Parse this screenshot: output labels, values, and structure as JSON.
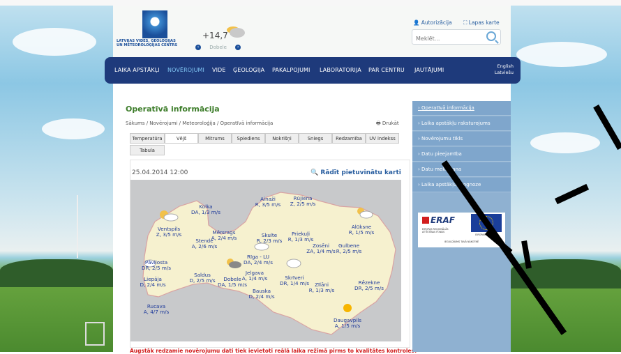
{
  "header": {
    "logo_text": "LATVIJAS VIDES, ĢEOLOĢIJAS UN METEOROLOĢIJAS CENTRS",
    "temperature": "+14,7",
    "city": "Dobele",
    "auth_link": "Autorizācija",
    "sitemap_link": "Lapas karte",
    "search_placeholder": "Meklēt..."
  },
  "nav": {
    "items": [
      "LAIKA APSTĀKĻI",
      "NOVĒROJUMI",
      "VIDE",
      "ĢEOLOĢIJA",
      "PAKALPOJUMI",
      "LABORATORIJA",
      "PAR CENTRU",
      "JAUTĀJUMI"
    ],
    "active_index": 1,
    "lang_en": "English",
    "lang_lv": "Latviešu"
  },
  "content": {
    "title": "Operatīvā informācija",
    "breadcrumb": "Sākums / Novērojumi / Meteoroloģija / Operatīvā informācija",
    "print": "Drukāt",
    "tabs": [
      "Temperatūra",
      "Vējš",
      "Mitrums",
      "Spiediens",
      "Nokrišņi",
      "Sniegs",
      "Redzamība",
      "UV indekss",
      "Tabula"
    ],
    "active_tab": 1,
    "date": "25.04.2014 12:00",
    "show_map": "Rādīt pietuvinātu karti",
    "warning": "Augstāk redzamie novērojumu dati tiek ievietoti reālā laika režīmā pirms to kvalitātes kontroles!"
  },
  "stations": [
    {
      "name": "Kolka",
      "wind": "DA, 1/3 m/s"
    },
    {
      "name": "Ainaži",
      "wind": "R, 3/5 m/s"
    },
    {
      "name": "Rūjiena",
      "wind": "Z, 2/5 m/s"
    },
    {
      "name": "Ventspils",
      "wind": "Z, 3/5 m/s"
    },
    {
      "name": "Mērsrags",
      "wind": "A, 2/4 m/s"
    },
    {
      "name": "Stende",
      "wind": "A, 2/6 m/s"
    },
    {
      "name": "Skulte",
      "wind": "R, 2/3 m/s"
    },
    {
      "name": "Priekuļi",
      "wind": "R, 1/3 m/s"
    },
    {
      "name": "Alūksne",
      "wind": "R, 1/5 m/s"
    },
    {
      "name": "Zosēni",
      "wind": "ZA, 1/4 m/s"
    },
    {
      "name": "Gulbene",
      "wind": "R, 2/5 m/s"
    },
    {
      "name": "Pāvilosta",
      "wind": "DR, 2/5 m/s"
    },
    {
      "name": "Rīga - LU",
      "wind": "DA, 2/4 m/s"
    },
    {
      "name": "Liepāja",
      "wind": "D, 2/4 m/s"
    },
    {
      "name": "Saldus",
      "wind": "D, 2/5 m/s"
    },
    {
      "name": "Dobele",
      "wind": "DA, 1/5 m/s"
    },
    {
      "name": "Jelgava",
      "wind": "A, 1/4 m/s"
    },
    {
      "name": "Skrīveri",
      "wind": "DR, 1/4 m/s"
    },
    {
      "name": "Zīlāni",
      "wind": "R, 1/3 m/s"
    },
    {
      "name": "Rēzekne",
      "wind": "DR, 2/5 m/s"
    },
    {
      "name": "Bauska",
      "wind": "D, 2/4 m/s"
    },
    {
      "name": "Rucava",
      "wind": "A, 4/7 m/s"
    },
    {
      "name": "Daugavpils",
      "wind": "A, 1/5 m/s"
    }
  ],
  "sidebar": {
    "items": [
      "Operatīvā informācija",
      "Laika apstākļu raksturojums",
      "Novērojumu tīkls",
      "Datu pieejamība",
      "Datu meklēšana",
      "Laika apstākļu prognoze"
    ]
  },
  "eraf": {
    "label": "ERAF",
    "left_caption": "EIROPAS REĢIONĀLĀS ATTĪSTĪBAS FONDS",
    "right_caption": "EIROPAS SAVIENĪBA",
    "bottom_caption": "IEGULDĪJUMS TAVĀ NĀKOTNĒ"
  },
  "colors": {
    "nav": "#1e3a7b",
    "title": "#3d7d2a",
    "land": "#f6f1cf",
    "sea": "#c8c9cb",
    "warning": "#d21e1e"
  }
}
